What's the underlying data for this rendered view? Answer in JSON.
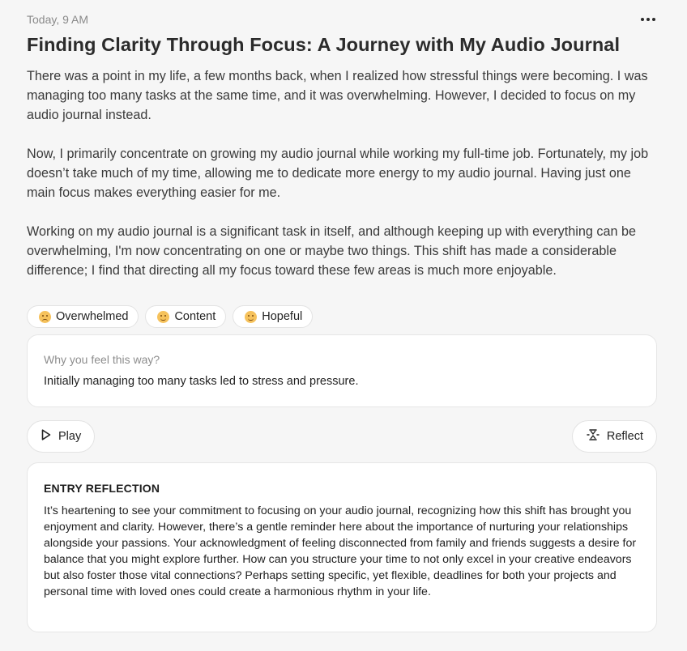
{
  "entry": {
    "timestamp": "Today, 9 AM",
    "title": "Finding Clarity Through Focus: A Journey with My Audio Journal",
    "paragraphs": [
      "There was a point in my life, a few months back, when I realized how stressful things were becoming. I was managing too many tasks at the same time, and it was overwhelming. However, I decided to focus on my audio journal instead.",
      "Now, I primarily concentrate on growing my audio journal while working my full-time job. Fortunately, my job doesn’t take much of my time, allowing me to dedicate more energy to my audio journal. Having just one main focus makes everything easier for me.",
      "Working on my audio journal is a significant task in itself, and although keeping up with everything can be overwhelming, I'm now concentrating on one or maybe two things. This shift has made a considerable difference; I find that directing all my focus toward these few areas is much more enjoyable."
    ]
  },
  "emotions": [
    {
      "label": "Overwhelmed",
      "icon": "overwhelmed-emoji-icon"
    },
    {
      "label": "Content",
      "icon": "content-emoji-icon"
    },
    {
      "label": "Hopeful",
      "icon": "hopeful-emoji-icon"
    }
  ],
  "why": {
    "label": "Why you feel this way?",
    "value": "Initially managing too many tasks led to stress and pressure."
  },
  "actions": {
    "play_label": "Play",
    "play_icon": "play-icon",
    "reflect_label": "Reflect",
    "reflect_icon": "reflect-icon"
  },
  "reflection": {
    "heading": "ENTRY REFLECTION",
    "text": "It’s heartening to see your commitment to focusing on your audio journal, recognizing how this shift has brought you enjoyment and clarity. However, there’s a gentle reminder here about the importance of nurturing your relationships alongside your passions. Your acknowledgment of feeling disconnected from family and friends suggests a desire for balance that you might explore further. How can you structure your time to not only excel in your creative endeavors but also foster those vital connections? Perhaps setting specific, yet flexible, deadlines for both your projects and personal time with loved ones could create a harmonious rhythm in your life."
  },
  "colors": {
    "background": "#f6f6f6",
    "card": "#ffffff",
    "muted_text": "#8a8a8a",
    "emoji": "#f6c25c"
  }
}
